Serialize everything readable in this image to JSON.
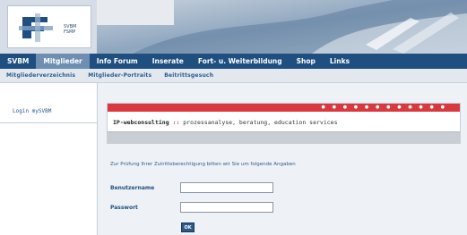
{
  "header": {
    "logo_text_line1": "SVBM",
    "logo_text_line2": "FSMP"
  },
  "nav_main": [
    {
      "label": "SVBM"
    },
    {
      "label": "Mitglieder"
    },
    {
      "label": "Info Forum"
    },
    {
      "label": "Inserate"
    },
    {
      "label": "Fort- u. Weiterbildung"
    },
    {
      "label": "Shop"
    },
    {
      "label": "Links"
    }
  ],
  "nav_sub": [
    {
      "label": "Mitgliederverzeichnis"
    },
    {
      "label": "Mitglieder-Portraits"
    },
    {
      "label": "Beitrittsgesuch"
    }
  ],
  "sidebar": {
    "login_link": "Login mySVBM"
  },
  "banner": {
    "brand": "IP-webconsulting",
    "separator": "::",
    "tagline": "prozessanalyse, beratung, education services",
    "dots": "● ● ● ● ● ● ● ● ● ● ● ●"
  },
  "login": {
    "intro": "Zur Prüfung Ihrer Zutrittsberechtigung bitten wir Sie um folgende Angaben",
    "username_label": "Benutzername",
    "password_label": "Passwort",
    "username_value": "",
    "password_value": "",
    "submit_label": "OK"
  },
  "colors": {
    "nav_bg": "#1f4f80",
    "nav_active": "#6f8fb2",
    "banner_red": "#d8383e",
    "link_blue": "#2a5a8c"
  }
}
